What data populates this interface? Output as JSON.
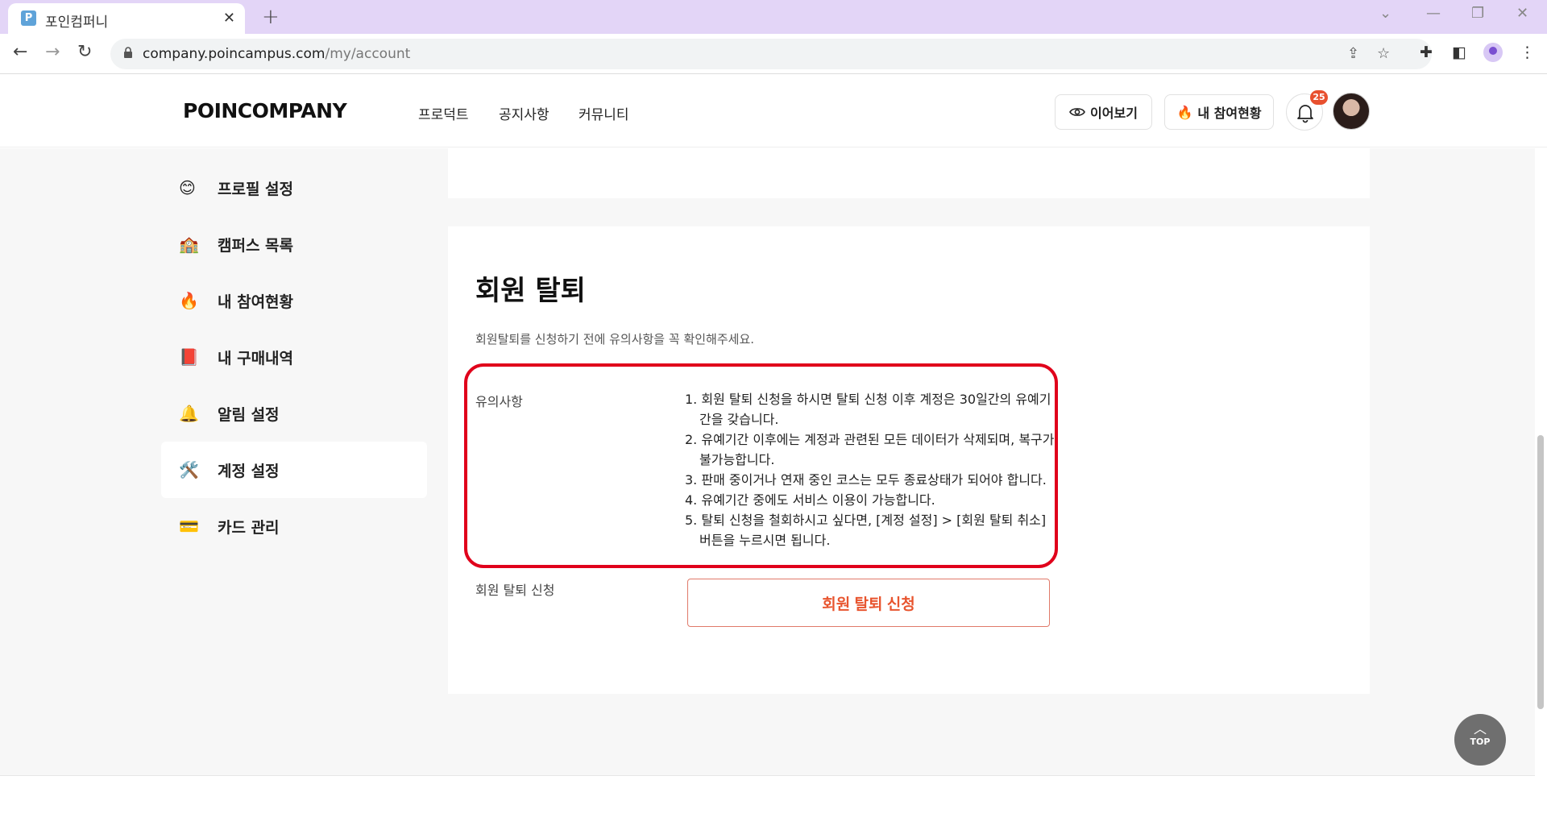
{
  "browser": {
    "tab_title": "포인컴퍼니",
    "tab_favicon": "P",
    "url_host": "company.poincampus.com",
    "url_path": "/my/account"
  },
  "header": {
    "logo": "POINCOMPANY",
    "nav": [
      "프로덕트",
      "공지사항",
      "커뮤니티"
    ],
    "continue_button": "이어보기",
    "participation_button": "내 참여현황",
    "notification_count": "25"
  },
  "sidebar": {
    "items": [
      {
        "emoji": "😊",
        "label": "프로필 설정"
      },
      {
        "emoji": "🏫",
        "label": "캠퍼스 목록"
      },
      {
        "emoji": "🔥",
        "label": "내 참여현황"
      },
      {
        "emoji": "📕",
        "label": "내 구매내역"
      },
      {
        "emoji": "🔔",
        "label": "알림 설정"
      },
      {
        "emoji": "🛠️",
        "label": "계정 설정"
      },
      {
        "emoji": "💳",
        "label": "카드 관리"
      }
    ]
  },
  "withdrawal": {
    "title": "회원 탈퇴",
    "subtitle": "회원탈퇴를 신청하기 전에 유의사항을 꼭 확인해주세요.",
    "notice_label": "유의사항",
    "notices": [
      "1. 회원 탈퇴 신청을 하시면 탈퇴 신청 이후 계정은 30일간의 유예기간을 갖습니다.",
      "2. 유예기간 이후에는 계정과 관련된 모든 데이터가 삭제되며, 복구가 불가능합니다.",
      "3. 판매 중이거나 연재 중인 코스는 모두 종료상태가 되어야 합니다.",
      "4. 유예기간 중에도 서비스 이용이 가능합니다.",
      "5. 탈퇴 신청을 철회하시고 싶다면, [계정 설정] > [회원 탈퇴 취소] 버튼을 누르시면 됩니다."
    ],
    "request_label": "회원 탈퇴 신청",
    "request_button": "회원 탈퇴 신청"
  },
  "top_button": "TOP",
  "colors": {
    "tab_strip": "#e3d5f7",
    "highlight_border": "#e0001b",
    "withdraw_text": "#e8552f",
    "badge": "#e8502f"
  }
}
